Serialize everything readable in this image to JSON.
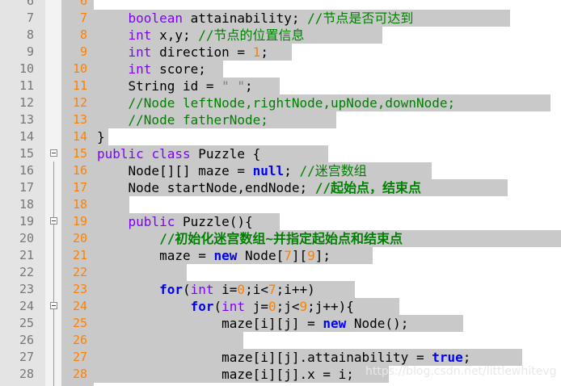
{
  "watermark": "https://blog.csdn.net/littlewhitevg",
  "lines": [
    {
      "n": "6",
      "d": "6",
      "hl": 0,
      "t": []
    },
    {
      "n": "7",
      "d": "7",
      "hl": 515,
      "t": [
        [
          "    ",
          ""
        ],
        [
          "boolean",
          "kw"
        ],
        [
          " attainability; ",
          ""
        ],
        [
          "//节点是否可达到",
          "cm"
        ]
      ]
    },
    {
      "n": "8",
      "d": "8",
      "hl": 357,
      "t": [
        [
          "    ",
          ""
        ],
        [
          "int",
          "kw"
        ],
        [
          " x,y; ",
          ""
        ],
        [
          "//节点的位置信息",
          "cm"
        ]
      ]
    },
    {
      "n": "9",
      "d": "9",
      "hl": 245,
      "t": [
        [
          "    ",
          ""
        ],
        [
          "int",
          "kw"
        ],
        [
          " direction = ",
          ""
        ],
        [
          "1",
          "num"
        ],
        [
          ";",
          ""
        ]
      ]
    },
    {
      "n": "10",
      "d": "10",
      "hl": 160,
      "t": [
        [
          "    ",
          ""
        ],
        [
          "int",
          "kw"
        ],
        [
          " score;",
          ""
        ]
      ]
    },
    {
      "n": "11",
      "d": "11",
      "hl": 230,
      "t": [
        [
          "    String id = ",
          ""
        ],
        [
          "\" \"",
          "str"
        ],
        [
          ";",
          ""
        ]
      ]
    },
    {
      "n": "12",
      "d": "12",
      "hl": 565,
      "t": [
        [
          "    ",
          ""
        ],
        [
          "//Node leftNode,rightNode,upNode,downNode;",
          "cm"
        ]
      ]
    },
    {
      "n": "13",
      "d": "13",
      "hl": 300,
      "t": [
        [
          "    ",
          ""
        ],
        [
          "//Node fatherNode;",
          "cm"
        ]
      ]
    },
    {
      "n": "14",
      "d": "14",
      "hl": 18,
      "t": [
        [
          "}",
          ""
        ]
      ]
    },
    {
      "n": "15",
      "d": "15",
      "hl": 290,
      "fold": true,
      "t": [
        [
          "public",
          "kw"
        ],
        [
          " ",
          ""
        ],
        [
          "class",
          "kw"
        ],
        [
          " Puzzle {",
          ""
        ]
      ]
    },
    {
      "n": "16",
      "d": "16",
      "hl": 418,
      "t": [
        [
          "    Node[][] maze = ",
          ""
        ],
        [
          "null",
          "kwb"
        ],
        [
          "; ",
          ""
        ],
        [
          "//迷宫数组",
          "cm"
        ]
      ]
    },
    {
      "n": "17",
      "d": "17",
      "hl": 512,
      "t": [
        [
          "    Node startNode,endNode; ",
          ""
        ],
        [
          "//起始点，结束点",
          "cmb"
        ]
      ]
    },
    {
      "n": "18",
      "d": "18",
      "hl": 44,
      "t": [
        [
          "    ",
          ""
        ]
      ]
    },
    {
      "n": "19",
      "d": "19",
      "hl": 230,
      "fold": true,
      "t": [
        [
          "    ",
          ""
        ],
        [
          "public",
          "kw"
        ],
        [
          " Puzzle(){",
          ""
        ]
      ]
    },
    {
      "n": "20",
      "d": "20",
      "hl": 578,
      "t": [
        [
          "        ",
          ""
        ],
        [
          "//初始化迷宫数组~并指定起始点和结束点",
          "cmb"
        ]
      ]
    },
    {
      "n": "21",
      "d": "21",
      "hl": 345,
      "t": [
        [
          "        maze = ",
          ""
        ],
        [
          "new",
          "kwb"
        ],
        [
          " Node[",
          ""
        ],
        [
          "7",
          "num"
        ],
        [
          "][",
          ""
        ],
        [
          "9",
          "num"
        ],
        [
          "];",
          ""
        ]
      ]
    },
    {
      "n": "22",
      "d": "22",
      "hl": 115,
      "t": [
        [
          "        ",
          ""
        ]
      ]
    },
    {
      "n": "23",
      "d": "23",
      "hl": 323,
      "t": [
        [
          "        ",
          ""
        ],
        [
          "for",
          "kwb"
        ],
        [
          "(",
          ""
        ],
        [
          "int",
          "kw"
        ],
        [
          " i=",
          ""
        ],
        [
          "0",
          "num"
        ],
        [
          ";i<",
          ""
        ],
        [
          "7",
          "num"
        ],
        [
          ";i++)",
          ""
        ]
      ]
    },
    {
      "n": "24",
      "d": "24",
      "hl": 378,
      "fold": true,
      "t": [
        [
          "            ",
          ""
        ],
        [
          "for",
          "kwb"
        ],
        [
          "(",
          ""
        ],
        [
          "int",
          "kw"
        ],
        [
          " j=",
          ""
        ],
        [
          "0",
          "num"
        ],
        [
          ";j<",
          ""
        ],
        [
          "9",
          "num"
        ],
        [
          ";j++){",
          ""
        ]
      ]
    },
    {
      "n": "25",
      "d": "25",
      "hl": 457,
      "t": [
        [
          "                maze[i][j] = ",
          ""
        ],
        [
          "new",
          "kwb"
        ],
        [
          " Node();",
          ""
        ]
      ]
    },
    {
      "n": "26",
      "d": "26",
      "hl": 185,
      "t": [
        [
          "                ",
          ""
        ]
      ]
    },
    {
      "n": "27",
      "d": "27",
      "hl": 530,
      "t": [
        [
          "                maze[i][j].attainability = ",
          ""
        ],
        [
          "true",
          "kwb"
        ],
        [
          ";",
          ""
        ]
      ]
    },
    {
      "n": "28",
      "d": "28",
      "hl": 365,
      "t": [
        [
          "                maze[i][j].x = i;",
          ""
        ]
      ]
    }
  ]
}
